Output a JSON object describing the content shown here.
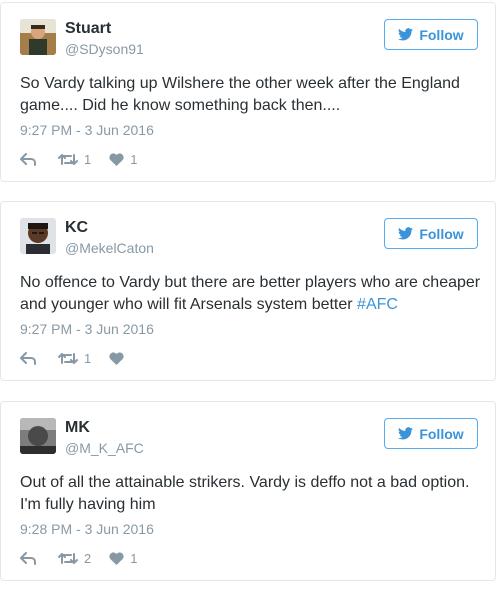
{
  "tweets": [
    {
      "display_name": "Stuart",
      "handle": "@SDyson91",
      "follow_label": "Follow",
      "text": "So Vardy talking up Wilshere the other week after the England game.... Did he know something back then....",
      "hashtag": "",
      "timestamp": "9:27 PM - 3 Jun 2016",
      "retweets": "1",
      "likes": "1"
    },
    {
      "display_name": "KC",
      "handle": "@MekelCaton",
      "follow_label": "Follow",
      "text": "No offence to Vardy but there are better players who are cheaper and younger who will fit Arsenals system better ",
      "hashtag": "#AFC",
      "timestamp": "9:27 PM - 3 Jun 2016",
      "retweets": "1",
      "likes": ""
    },
    {
      "display_name": "MK",
      "handle": "@M_K_AFC",
      "follow_label": "Follow",
      "text": "Out of all the attainable strikers. Vardy is deffo not a bad option. I'm fully having him",
      "hashtag": "",
      "timestamp": "9:28 PM - 3 Jun 2016",
      "retweets": "2",
      "likes": "1"
    }
  ],
  "colors": {
    "link_blue": "#3b94d9",
    "follow_border": "#55acee",
    "muted_gray": "#8899a6",
    "text_dark": "#292f33",
    "card_border": "#e1e8ed"
  },
  "icons": {
    "follow": "twitter-bird-icon",
    "reply": "reply-icon",
    "retweet": "retweet-icon",
    "like": "heart-icon"
  }
}
